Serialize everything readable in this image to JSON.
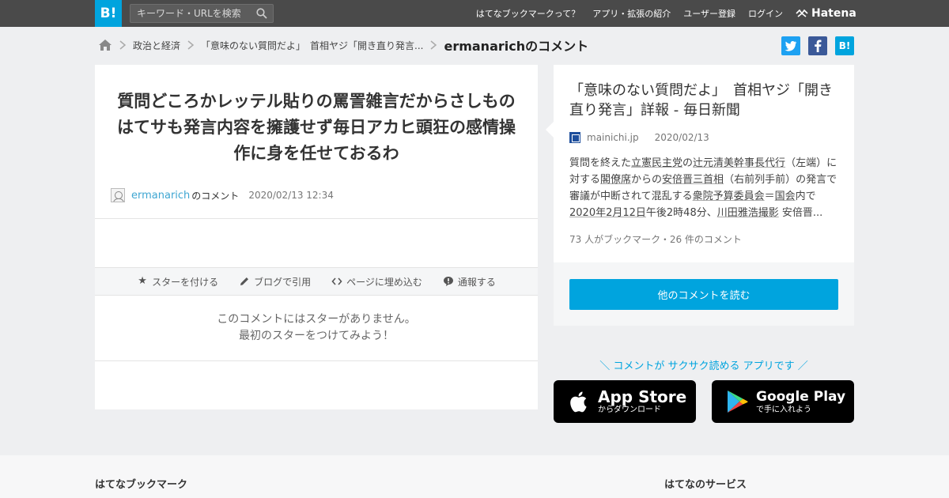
{
  "header": {
    "logo": "B!",
    "search_placeholder": "キーワード・URLを検索",
    "nav": [
      "はてなブックマークって？",
      "アプリ・拡張の紹介",
      "ユーザー登録",
      "ログイン"
    ],
    "brand": "Hatena"
  },
  "breadcrumb": {
    "items": [
      "政治と経済",
      "「意味のない質問だよ」　首相ヤジ「開き直り発言...",
      "ermanarichのコメント"
    ]
  },
  "share": {
    "hatena_label": "B!"
  },
  "comment": {
    "text": "質問どころかレッテル貼りの罵詈雑言だからさしものはてサも発言内容を擁護せず毎日アカヒ頭狂の感情操作に身を任せておるわ",
    "user": "ermanarich",
    "user_suffix": "のコメント",
    "date": "2020/02/13 12:34"
  },
  "actions": [
    {
      "label": "スターを付ける",
      "icon": "star-icon"
    },
    {
      "label": "ブログで引用",
      "icon": "pencil-icon"
    },
    {
      "label": "ページに埋め込む",
      "icon": "code-icon"
    },
    {
      "label": "通報する",
      "icon": "report-icon"
    }
  ],
  "no_star": {
    "line1": "このコメントにはスターがありません。",
    "line2": "最初のスターをつけてみよう！"
  },
  "entry": {
    "title": "「意味のない質問だよ」　首相ヤジ「開き直り発言」詳報 - 毎日新聞",
    "site": "mainichi.jp",
    "date": "2020/02/13",
    "summary": {
      "p1": "質問を終えた",
      "p2": "立憲民主党",
      "p3": "の",
      "p4": "辻元清美幹事長代行",
      "p5": "（左端）に対する",
      "p6": "閣僚席",
      "p7": "からの",
      "p8": "安倍晋三首相",
      "p9": "（右前列手前）の発言で審議が中断されて混乱する",
      "p10": "衆院予算委員会",
      "p11": "＝",
      "p12": "国会",
      "p13": "内で",
      "p14": "2020年2月12日",
      "p15": "午後2時48分、",
      "p16": "川田雅浩撮影",
      "p17": " 安倍晋..."
    },
    "counts": "73 人がブックマーク・26 件のコメント",
    "read_button": "他のコメントを読む"
  },
  "promo": {
    "tagline": "＼ コメントが サクサク読める アプリです ／",
    "apple_title": "App Store",
    "apple_sub": "からダウンロード",
    "google_title": "Google Play",
    "google_sub": "で手に入れよう"
  },
  "footer": {
    "left": "はてなブックマーク",
    "right": "はてなのサービス"
  },
  "colors": {
    "brand_blue": "#00a4de",
    "topbar": "#4a4a4a",
    "twitter": "#1da1f2",
    "facebook": "#3b5998"
  }
}
